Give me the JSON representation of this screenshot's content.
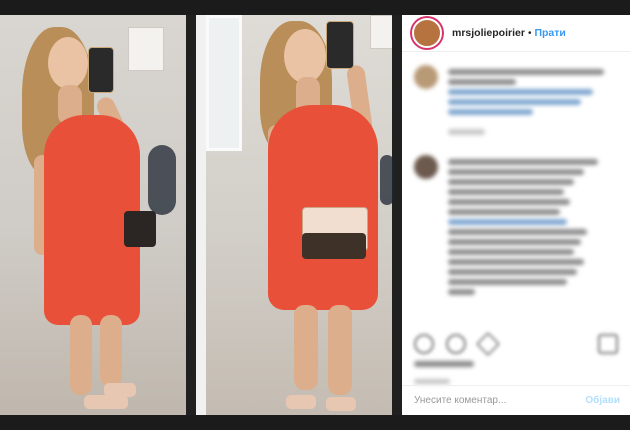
{
  "header": {
    "username": "mrsjoliepoirier",
    "separator": "•",
    "follow_label": "Прати"
  },
  "comment_box": {
    "placeholder": "Унесите коментар...",
    "post_label": "Објави"
  },
  "colors": {
    "accent": "#3897f0",
    "dress": "#e8503a",
    "background": "#1b1b1b"
  },
  "icons": {
    "like": "heart-icon",
    "comment": "comment-icon",
    "share": "share-icon",
    "save": "bookmark-icon"
  }
}
